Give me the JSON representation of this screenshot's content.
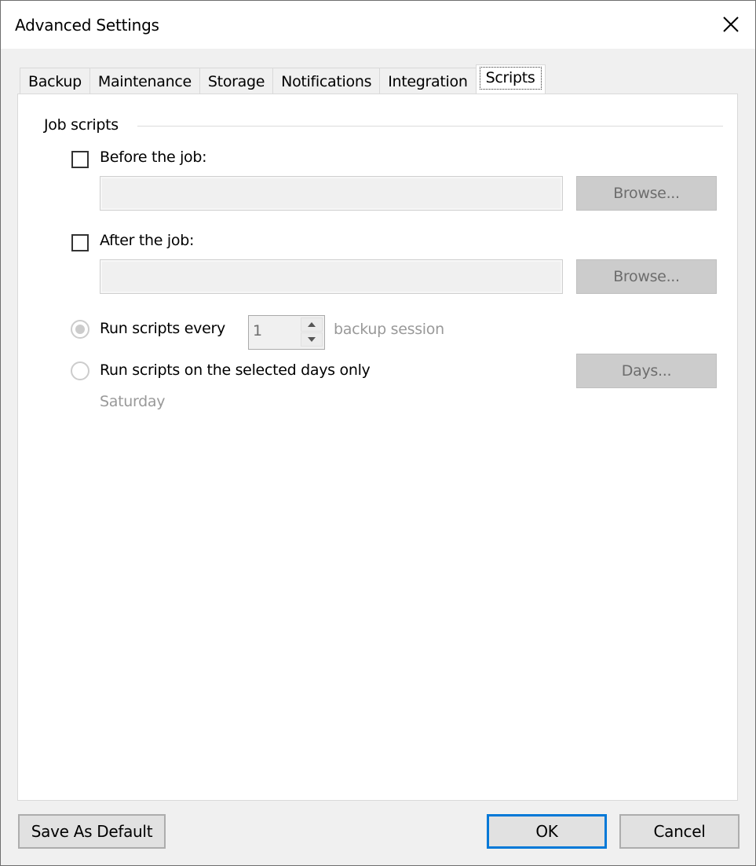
{
  "window": {
    "title": "Advanced Settings",
    "close_icon": "close-icon"
  },
  "tabs": [
    {
      "label": "Backup",
      "active": false
    },
    {
      "label": "Maintenance",
      "active": false
    },
    {
      "label": "Storage",
      "active": false
    },
    {
      "label": "Notifications",
      "active": false
    },
    {
      "label": "Integration",
      "active": false
    },
    {
      "label": "Scripts",
      "active": true
    }
  ],
  "job_scripts": {
    "group_title": "Job scripts",
    "before": {
      "label": "Before the job:",
      "checked": false,
      "path_value": "",
      "browse_label": "Browse..."
    },
    "after": {
      "label": "After the job:",
      "checked": false,
      "path_value": "",
      "browse_label": "Browse..."
    },
    "run_every": {
      "label": "Run scripts every",
      "selected": true,
      "value": "1",
      "suffix": "backup session"
    },
    "run_days": {
      "label": "Run scripts on the selected days only",
      "selected": false,
      "days_button_label": "Days...",
      "selected_days": "Saturday"
    }
  },
  "footer": {
    "save_default_label": "Save As Default",
    "ok_label": "OK",
    "cancel_label": "Cancel"
  },
  "colors": {
    "accent": "#0078d7",
    "disabled_text": "#999999",
    "disabled_button": "#cccccc"
  }
}
